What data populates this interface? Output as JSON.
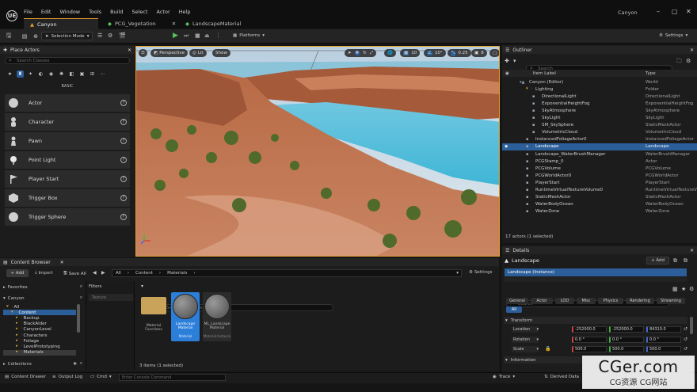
{
  "app": {
    "logo": "UE",
    "project": "Canyon",
    "menu": [
      "File",
      "Edit",
      "Window",
      "Tools",
      "Build",
      "Select",
      "Actor",
      "Help"
    ],
    "tabs": [
      {
        "label": "Canyon",
        "active": true
      },
      {
        "label": "PCG_Vegetation",
        "active": false
      },
      {
        "label": "LandscapeMaterial",
        "active": false
      }
    ]
  },
  "toolbar": {
    "selection_mode": "Selection Mode",
    "platforms": "Platforms",
    "settings": "Settings"
  },
  "place_actors": {
    "title": "Place Actors",
    "search_placeholder": "Search Classes",
    "category": "BASIC",
    "items": [
      "Actor",
      "Character",
      "Pawn",
      "Point Light",
      "Player Start",
      "Trigger Box",
      "Trigger Sphere"
    ]
  },
  "viewport": {
    "perspective": "Perspective",
    "lit": "Lit",
    "show": "Show",
    "snap_angle": "10°",
    "snap_scale": "0.25",
    "camera_speed": "8"
  },
  "outliner": {
    "title": "Outliner",
    "search_placeholder": "Search",
    "col_label": "Item Label",
    "col_type": "Type",
    "rows": [
      {
        "label": "Canyon (Editor)",
        "type": "World",
        "indent": 1
      },
      {
        "label": "Lighting",
        "type": "Folder",
        "indent": 2
      },
      {
        "label": "DirectionalLight",
        "type": "DirectionalLight",
        "indent": 3
      },
      {
        "label": "ExponentialHeightFog",
        "type": "ExponentialHeightFog",
        "indent": 3
      },
      {
        "label": "SkyAtmosphere",
        "type": "SkyAtmosphere",
        "indent": 3
      },
      {
        "label": "SkyLight",
        "type": "SkyLight",
        "indent": 3
      },
      {
        "label": "SM_SkySphere",
        "type": "StaticMeshActor",
        "indent": 3
      },
      {
        "label": "VolumetricCloud",
        "type": "VolumetricCloud",
        "indent": 3
      },
      {
        "label": "InstancedFoliageActor0",
        "type": "InstancedFoliageActor",
        "indent": 2
      },
      {
        "label": "Landscape",
        "type": "Landscape",
        "indent": 2,
        "selected": true
      },
      {
        "label": "Landscape_WaterBrushManager",
        "type": "WaterBrushManager",
        "indent": 2
      },
      {
        "label": "PCGStamp_0",
        "type": "Actor",
        "indent": 2
      },
      {
        "label": "PCGVolume",
        "type": "PCGVolume",
        "indent": 2
      },
      {
        "label": "PCGWorldActor0",
        "type": "PCGWorldActor",
        "indent": 2
      },
      {
        "label": "PlayerStart",
        "type": "PlayerStart",
        "indent": 2
      },
      {
        "label": "RuntimeVirtualTextureVolume0",
        "type": "RuntimeVirtualTextureV",
        "indent": 2
      },
      {
        "label": "StaticMeshActor",
        "type": "StaticMeshActor",
        "indent": 2
      },
      {
        "label": "WaterBodyOcean",
        "type": "WaterBodyOcean",
        "indent": 2
      },
      {
        "label": "WaterZone",
        "type": "WaterZone",
        "indent": 2
      }
    ],
    "status": "17 actors (1 selected)"
  },
  "details": {
    "title": "Details",
    "actor_name": "Landscape",
    "add_label": "+ Add",
    "instance_label": "Landscape (Instance)",
    "search_placeholder": "Search",
    "tabs": [
      "General",
      "Actor",
      "LOD",
      "Misc",
      "Physics",
      "Rendering",
      "Streaming"
    ],
    "all_tab": "All",
    "section_transform": "Transform",
    "section_information": "Information",
    "transform": [
      {
        "label": "Location",
        "x": "-252000.0",
        "y": "-252000.0",
        "z": "84310.0"
      },
      {
        "label": "Rotation",
        "x": "0.0 °",
        "y": "0.0 °",
        "z": "0.0 °"
      },
      {
        "label": "Scale",
        "x": "500.0",
        "y": "500.0",
        "z": "500.0"
      }
    ]
  },
  "content_browser": {
    "title": "Content Browser",
    "add": "+ Add",
    "import": "Import",
    "save_all": "Save All",
    "breadcrumb": [
      "All",
      "Content",
      "Materials"
    ],
    "settings": "Settings",
    "favorites": "Favorites",
    "project": "Canyon",
    "filters": "Filters",
    "filter_chip": "Texture",
    "search_placeholder": "Search Materials",
    "tree": [
      {
        "label": "All",
        "indent": 0
      },
      {
        "label": "Content",
        "indent": 1,
        "selected": true
      },
      {
        "label": "Backup",
        "indent": 2
      },
      {
        "label": "BlackAlder",
        "indent": 2
      },
      {
        "label": "CanyonLevel",
        "indent": 2
      },
      {
        "label": "Characters",
        "indent": 2
      },
      {
        "label": "Foliage",
        "indent": 2
      },
      {
        "label": "LevelPrototyping",
        "indent": 2
      },
      {
        "label": "Materials",
        "indent": 2,
        "highlight": true
      }
    ],
    "collections": "Collections",
    "assets": [
      {
        "name": "Material Functions",
        "kind": "folder"
      },
      {
        "name": "Landscape Material",
        "sub": "Material",
        "kind": "material",
        "selected": true
      },
      {
        "name": "ML_Landscape Material",
        "sub": "Material Instance",
        "kind": "material"
      }
    ],
    "status": "3 items (1 selected)"
  },
  "statusbar": {
    "content_drawer": "Content Drawer",
    "output_log": "Output Log",
    "cmd": "Cmd",
    "console_placeholder": "Enter Console Command",
    "trace": "Trace",
    "derived_data": "Derived Data"
  },
  "watermark": {
    "main": "CGer.com",
    "sub": "CG资源 CG网站"
  }
}
